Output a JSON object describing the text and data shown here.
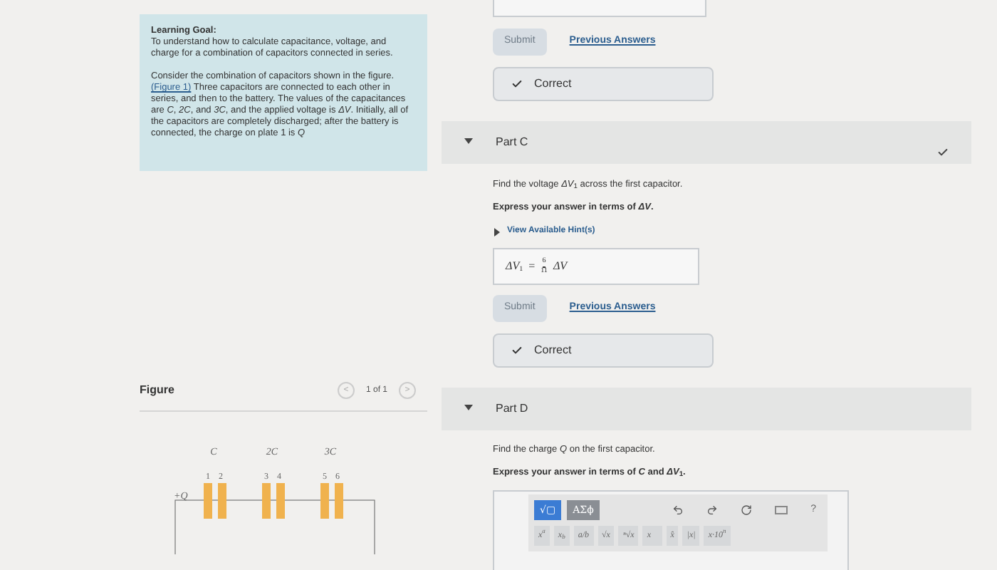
{
  "learning_goal": {
    "title": "Learning Goal:",
    "text": "To understand how to calculate capacitance, voltage, and charge for a combination of capacitors connected in series.",
    "body_parts": [
      "Consider the combination of capacitors shown in the figure. ",
      "(Figure 1)",
      " Three capacitors are connected to each other in series, and then to the battery. The values of the capacitances are *C*, *2C*, and *3C*, and the applied voltage is *ΔV*. Initially, all of the capacitors are completely discharged; after the battery is connected, the charge on plate 1 is *Q*"
    ]
  },
  "figure": {
    "title": "Figure",
    "pager": "1 of 1",
    "prev": "<",
    "next": ">",
    "capacitors": [
      {
        "label": "C",
        "plates": [
          "1",
          "2"
        ]
      },
      {
        "label": "2C",
        "plates": [
          "3",
          "4"
        ]
      },
      {
        "label": "3C",
        "plates": [
          "5",
          "6"
        ]
      }
    ],
    "charge": "+Q"
  },
  "part_b_tail": {
    "submit": {
      "label": "Submit",
      "disabled": true
    },
    "previous_answers": "Previous Answers",
    "feedback": "Correct"
  },
  "parts": [
    {
      "title": "Part C",
      "expanded": true,
      "completed": true,
      "question": "Find the voltage *ΔV*$_{1}$ across the first capacitor.",
      "instruction": "Express your answer in terms of *ΔV*.",
      "hints": "View Available Hint(s)",
      "answer": {
        "lhs": "ΔV",
        "lhs_sub": "1",
        "eq": "=",
        "num": "6",
        "den": "11",
        "rhs": "ΔV"
      },
      "submit": {
        "label": "Submit",
        "disabled": true
      },
      "previous_answers": "Previous Answers",
      "feedback": "Correct"
    },
    {
      "title": "Part D",
      "expanded": true,
      "completed": false,
      "question": "Find the charge *Q* on the first capacitor.",
      "instruction": "Express your answer in terms of *C* and *ΔV*$_{1}$.",
      "editor": {
        "tabs": [
          {
            "label": "√▢",
            "selected": true
          },
          {
            "label": "ΑΣϕ",
            "selected": false
          }
        ],
        "actions": [
          "?"
        ],
        "keys": [
          "x$^{a}$",
          "x$_{b}$",
          "a/b",
          "√x",
          "ⁿ√x",
          "x⃗",
          "x̂",
          "|x|",
          "x·10$^{n}$"
        ]
      }
    }
  ]
}
